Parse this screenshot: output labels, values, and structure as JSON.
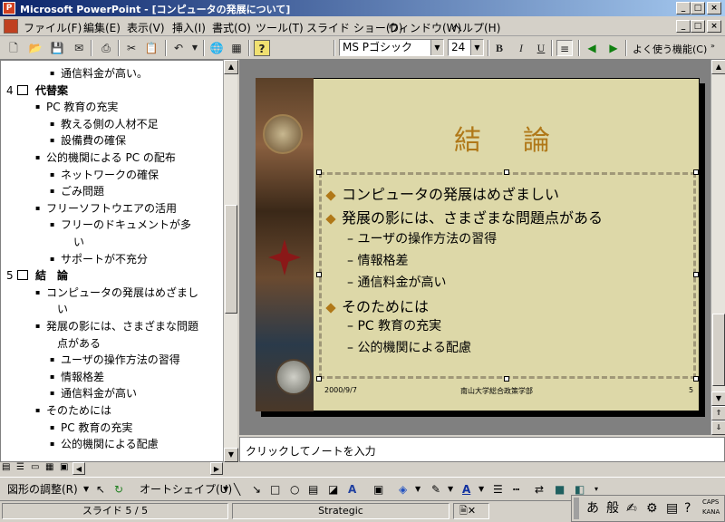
{
  "window": {
    "title": "Microsoft PowerPoint - [コンピュータの発展について]"
  },
  "menu": {
    "items": [
      "ファイル(F)",
      "編集(E)",
      "表示(V)",
      "挿入(I)",
      "書式(O)",
      "ツール(T)",
      "スライド ショー(D)",
      "ウィンドウ(W)",
      "ヘルプ(H)"
    ]
  },
  "toolbar": {
    "font_name": "MS Pゴシック",
    "font_size": "24",
    "bold": "B",
    "italic": "I",
    "underline": "U",
    "common_tasks": "よく使う機能(C)"
  },
  "outline": {
    "lines": [
      {
        "level": 2,
        "text": "通信料金が高い。"
      },
      {
        "level": 0,
        "num": "4",
        "text": "代替案"
      },
      {
        "level": 1,
        "text": "PC 教育の充実"
      },
      {
        "level": 2,
        "text": "教える側の人材不足"
      },
      {
        "level": 2,
        "text": "設備費の確保"
      },
      {
        "level": 1,
        "text": "公的機関による PC の配布"
      },
      {
        "level": 2,
        "text": "ネットワークの確保"
      },
      {
        "level": 2,
        "text": "ごみ問題"
      },
      {
        "level": 1,
        "text": "フリーソフトウエアの活用"
      },
      {
        "level": 2,
        "text": "フリーのドキュメントが多"
      },
      {
        "level": 3,
        "text": "い"
      },
      {
        "level": 2,
        "text": "サポートが不充分"
      },
      {
        "level": 0,
        "num": "5",
        "text": "結　論"
      },
      {
        "level": 1,
        "text": "コンピュータの発展はめざまし"
      },
      {
        "level": 4,
        "text": "い"
      },
      {
        "level": 1,
        "text": "発展の影には、さまざまな問題"
      },
      {
        "level": 4,
        "text": "点がある"
      },
      {
        "level": 2,
        "text": "ユーザの操作方法の習得"
      },
      {
        "level": 2,
        "text": "情報格差"
      },
      {
        "level": 2,
        "text": "通信料金が高い"
      },
      {
        "level": 1,
        "text": "そのためには"
      },
      {
        "level": 2,
        "text": "PC 教育の充実"
      },
      {
        "level": 2,
        "text": "公的機関による配慮"
      }
    ]
  },
  "slide": {
    "title": "結　論",
    "bullets": [
      {
        "level": 1,
        "text": "コンピュータの発展はめざましい"
      },
      {
        "level": 1,
        "text": "発展の影には、さまざまな問題点がある"
      },
      {
        "level": 2,
        "text": "ユーザの操作方法の習得"
      },
      {
        "level": 2,
        "text": "情報格差"
      },
      {
        "level": 2,
        "text": "通信料金が高い"
      },
      {
        "level": 1,
        "text": "そのためには"
      },
      {
        "level": 2,
        "text": "PC 教育の充実"
      },
      {
        "level": 2,
        "text": "公的機関による配慮"
      }
    ],
    "date": "2000/9/7",
    "organization": "南山大学総合政策学部",
    "number": "5"
  },
  "notes": {
    "placeholder": "クリックしてノートを入力"
  },
  "drawing": {
    "draw_label": "図形の調整(R)",
    "autoshape_label": "オートシェイプ(U)"
  },
  "status": {
    "slide": "スライド 5 / 5",
    "design": "Strategic"
  },
  "ime": {
    "mode": "あ",
    "kanji": "般",
    "caps": "CAPS",
    "kana": "KANA"
  }
}
